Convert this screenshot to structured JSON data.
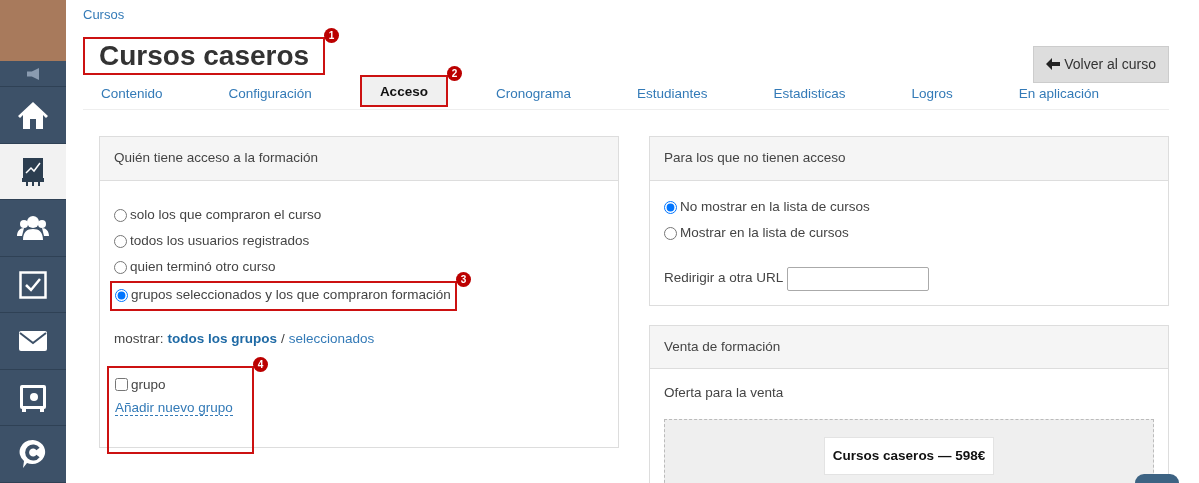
{
  "sidebar": {
    "items": [
      {
        "selected": false
      },
      {
        "selected": false
      },
      {
        "selected": true
      },
      {
        "selected": false
      },
      {
        "selected": false
      },
      {
        "selected": false
      },
      {
        "selected": false
      },
      {
        "selected": false
      }
    ]
  },
  "breadcrumb": "Cursos",
  "title": {
    "text": "Cursos caseros",
    "annotation": "1"
  },
  "back_button": "Volver al curso",
  "tabs": [
    {
      "label": "Contenido",
      "selected": false
    },
    {
      "label": "Configuración",
      "selected": false
    },
    {
      "label": "Acceso",
      "selected": true,
      "annotation": "2"
    },
    {
      "label": "Cronograma",
      "selected": false
    },
    {
      "label": "Estudiantes",
      "selected": false
    },
    {
      "label": "Estadisticas",
      "selected": false
    },
    {
      "label": "Logros",
      "selected": false
    },
    {
      "label": "En aplicación",
      "selected": false
    }
  ],
  "access_card": {
    "title": "Quién tiene acceso a la formación",
    "options": [
      {
        "label": "solo los que compraron el curso",
        "selected": false
      },
      {
        "label": "todos los usuarios registrados",
        "selected": false
      },
      {
        "label": "quien terminó otro curso",
        "selected": false
      },
      {
        "label": "grupos seleccionados y los que compraron formación",
        "selected": true,
        "annotation": "3"
      }
    ],
    "show_label": "mostrar:",
    "show_links": [
      {
        "label": "todos los grupos",
        "selected": true
      },
      {
        "label": "seleccionados",
        "selected": false
      }
    ],
    "show_separator": "/",
    "groups": {
      "annotation": "4",
      "items": [
        {
          "label": "grupo",
          "checked": false
        }
      ],
      "add_link": "Añadir nuevo grupo"
    }
  },
  "no_access_card": {
    "title": "Para los que no tienen acceso",
    "options": [
      {
        "label": "No mostrar en la lista de cursos",
        "selected": true
      },
      {
        "label": "Mostrar en la lista de cursos",
        "selected": false
      }
    ],
    "redirect_label": "Redirigir a otra URL"
  },
  "sale_card": {
    "title": "Venta de formación",
    "offer_label": "Oferta para la venta",
    "offer": "Cursos caseros — 598€"
  }
}
